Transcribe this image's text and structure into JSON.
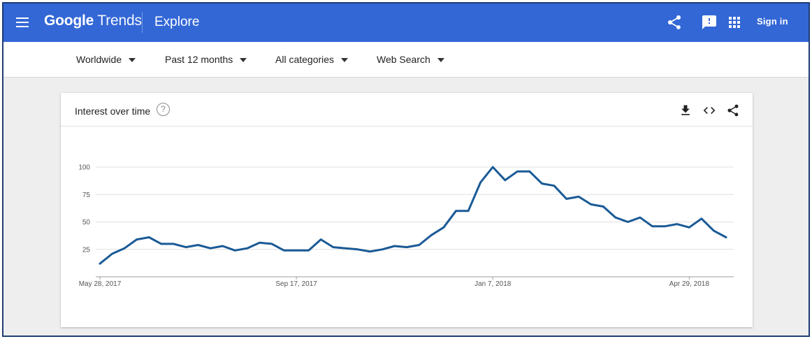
{
  "header": {
    "logo_brand": "Google",
    "logo_product": "Trends",
    "page_title": "Explore",
    "sign_in": "Sign in",
    "icons": [
      "menu-icon",
      "share-icon",
      "feedback-icon",
      "apps-icon"
    ],
    "color": "#3367d6"
  },
  "filters": {
    "location": "Worldwide",
    "time_range": "Past 12 months",
    "category": "All categories",
    "search_type": "Web Search"
  },
  "card": {
    "title": "Interest over time",
    "help_glyph": "?",
    "actions": [
      "download-icon",
      "embed-icon",
      "share-icon"
    ]
  },
  "chart_data": {
    "type": "line",
    "title": "Interest over time",
    "y_ticks": [
      25,
      50,
      75,
      100
    ],
    "ylim": [
      0,
      100
    ],
    "x_tick_labels": [
      "May 28, 2017",
      "Sep 17, 2017",
      "Jan 7, 2018",
      "Apr 29, 2018"
    ],
    "x_tick_index": [
      0,
      16,
      32,
      48
    ],
    "grid": true,
    "series": [
      {
        "color": "#1a5a96",
        "values": [
          12,
          21,
          26,
          34,
          36,
          30,
          30,
          27,
          29,
          26,
          28,
          24,
          26,
          31,
          30,
          24,
          24,
          24,
          34,
          27,
          26,
          25,
          23,
          25,
          28,
          27,
          29,
          38,
          45,
          60,
          60,
          86,
          100,
          88,
          96,
          96,
          85,
          83,
          71,
          73,
          66,
          64,
          54,
          50,
          54,
          46,
          46,
          48,
          45,
          53,
          42,
          36
        ]
      }
    ]
  }
}
